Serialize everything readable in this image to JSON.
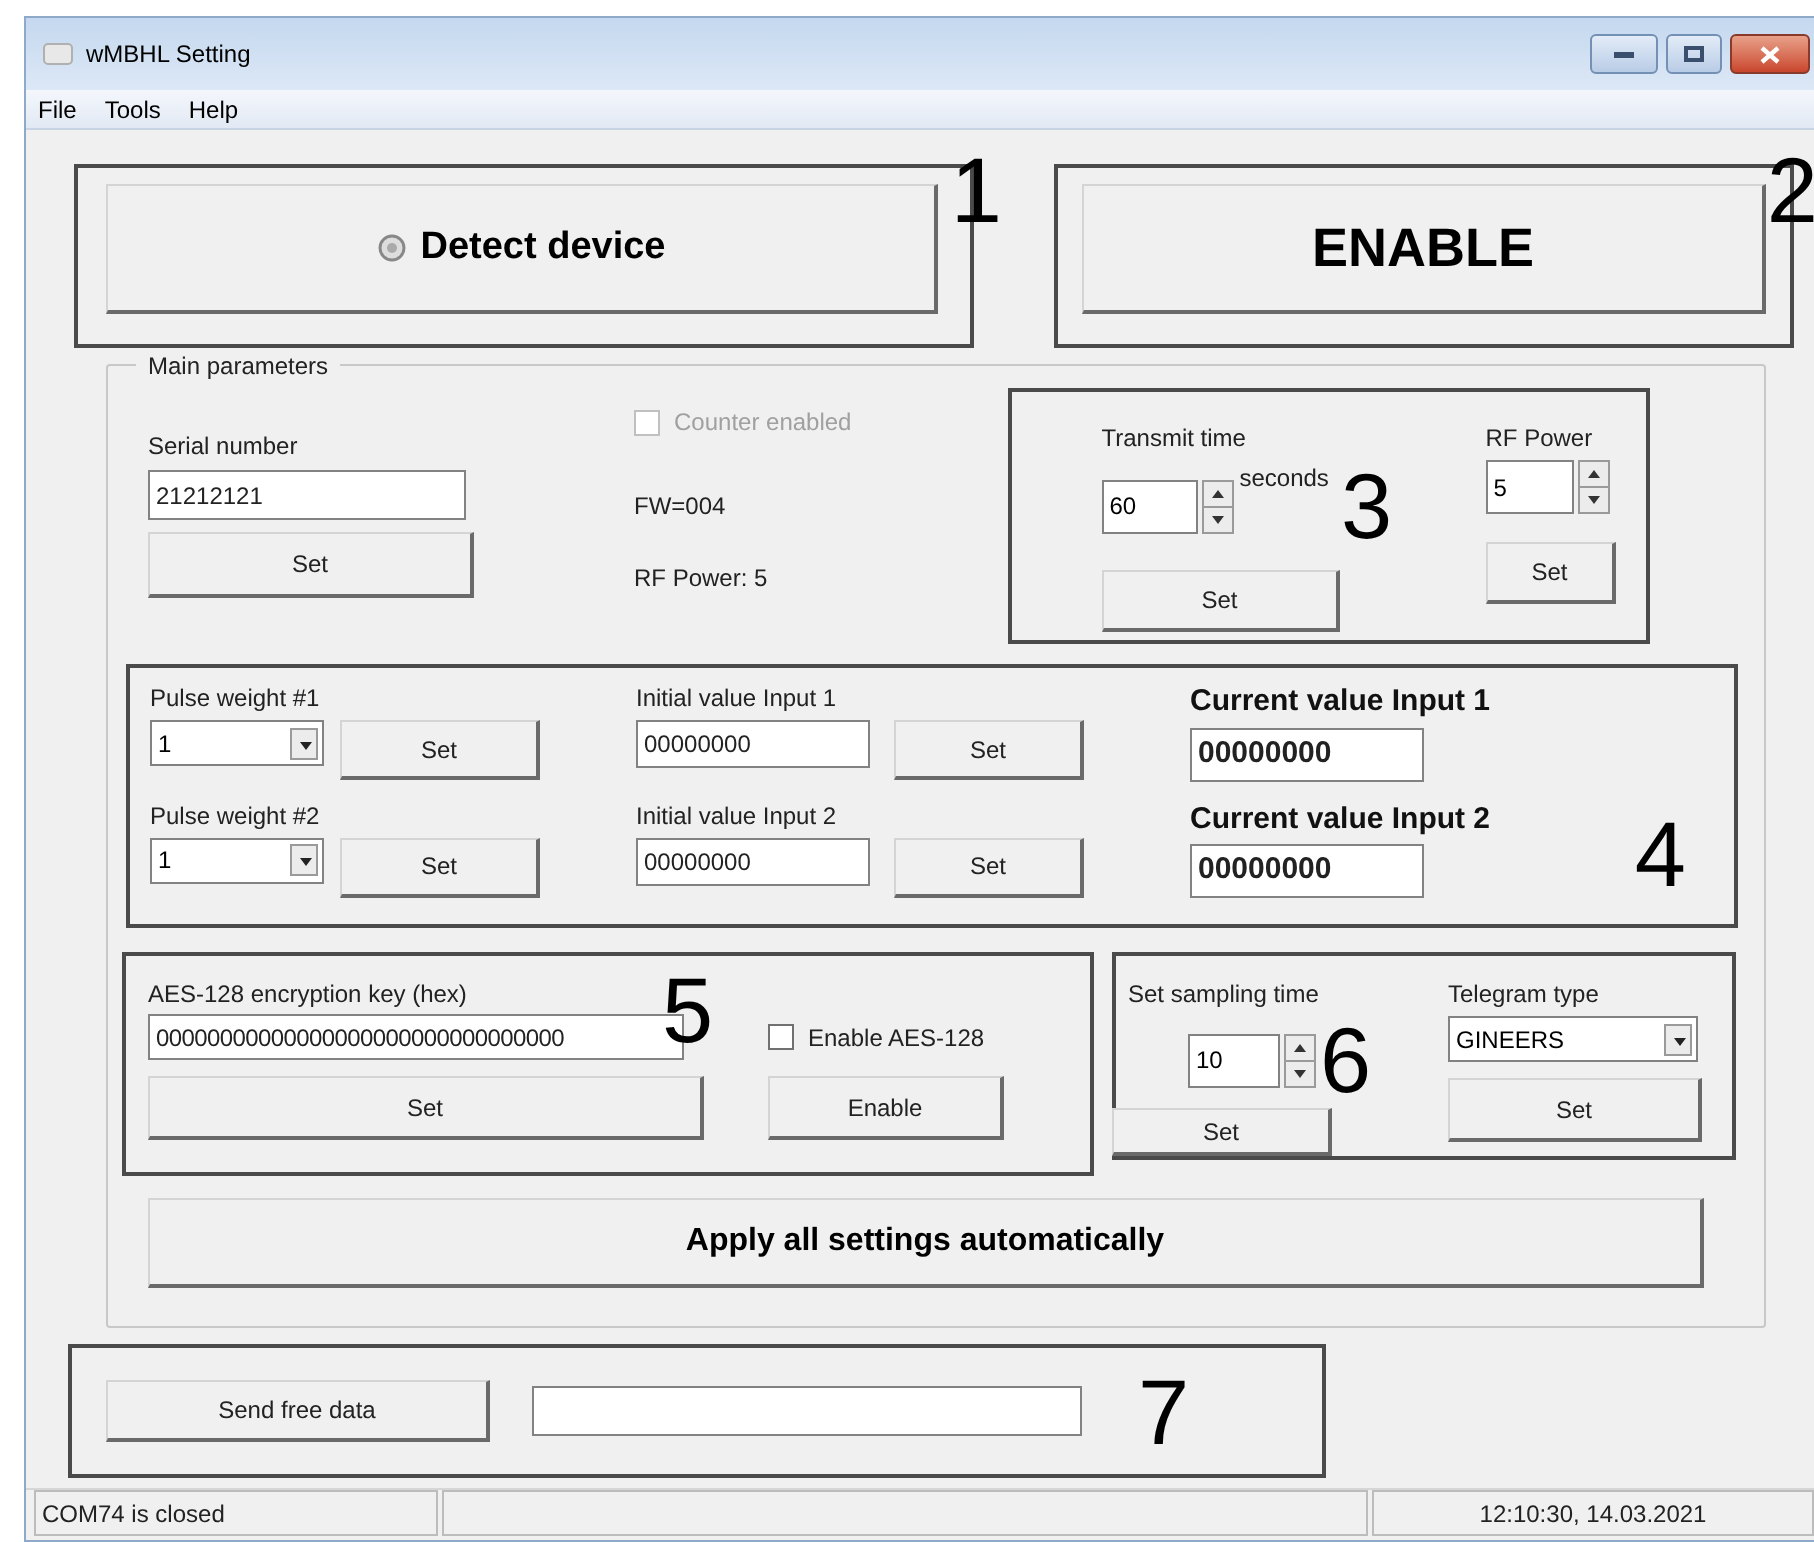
{
  "window": {
    "title": "wMBHL Setting"
  },
  "menu": [
    {
      "label": "File"
    },
    {
      "label": "Tools"
    },
    {
      "label": "Help"
    }
  ],
  "detect": {
    "label": "Detect device",
    "callout": "1"
  },
  "enable": {
    "label": "ENABLE",
    "callout": "2"
  },
  "main_parameters": {
    "title": "Main parameters",
    "serial_number": {
      "label": "Serial number",
      "value": "21212121",
      "button": "Set"
    },
    "counter_enabled": {
      "label": "Counter enabled",
      "checked": false,
      "disabled": true
    },
    "firmware": "FW=004",
    "rf_power_info": "RF Power: 5",
    "transmit": {
      "callout": "3",
      "time_label": "Transmit time",
      "time_value": "60",
      "unit": "seconds",
      "time_button": "Set",
      "rf_label": "RF Power",
      "rf_value": "5",
      "rf_button": "Set"
    },
    "inputs": {
      "callout": "4",
      "rows": [
        {
          "pulse_label": "Pulse weight #1",
          "pulse_value": "1",
          "pulse_button": "Set",
          "initial_label": "Initial value Input 1",
          "initial_value": "00000000",
          "initial_button": "Set",
          "current_label": "Current value Input 1",
          "current_value": "00000000"
        },
        {
          "pulse_label": "Pulse weight #2",
          "pulse_value": "1",
          "pulse_button": "Set",
          "initial_label": "Initial value Input 2",
          "initial_value": "00000000",
          "initial_button": "Set",
          "current_label": "Current value Input 2",
          "current_value": "00000000"
        }
      ]
    },
    "aes": {
      "callout": "5",
      "label": "AES-128 encryption key (hex)",
      "value": "00000000000000000000000000000000",
      "checkbox": {
        "label": "Enable AES-128",
        "checked": false
      },
      "set_button": "Set",
      "enable_button": "Enable"
    },
    "sampling": {
      "callout": "6",
      "label": "Set sampling time",
      "value": "10",
      "button": "Set",
      "telegram_label": "Telegram type",
      "telegram_value": "GINEERS",
      "telegram_button": "Set"
    },
    "apply_button": "Apply all settings automatically"
  },
  "free_data": {
    "button": "Send free data",
    "callout": "7"
  },
  "status_bar": {
    "status": "COM74 is closed",
    "datetime": "12:10:30, 14.03.2021"
  }
}
